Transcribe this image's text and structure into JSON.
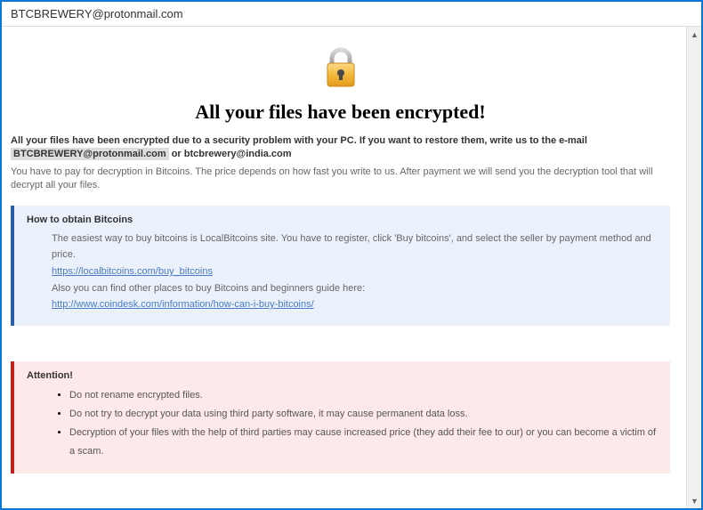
{
  "titlebar": "BTCBREWERY@protonmail.com",
  "heading": "All your files have been encrypted!",
  "intro_bold_prefix": "All your files have been encrypted due to a security problem with your PC. If you want to restore them, write us to the e-mail ",
  "email1": "BTCBREWERY@protonmail.com",
  "intro_bold_sep": " or ",
  "email2": "btcbrewery@india.com",
  "intro_text": "You have to pay for decryption in Bitcoins. The price depends on how fast you write to us. After payment we will send you the decryption tool that will decrypt all your files.",
  "bitcoins": {
    "title": "How to obtain Bitcoins",
    "line1": "The easiest way to buy bitcoins is LocalBitcoins site. You have to register, click 'Buy bitcoins', and select the seller by payment method and price.",
    "link1": "https://localbitcoins.com/buy_bitcoins",
    "line2": "Also you can find other places to buy Bitcoins and beginners guide here:",
    "link2": "http://www.coindesk.com/information/how-can-i-buy-bitcoins/"
  },
  "attention": {
    "title": "Attention!",
    "items": [
      "Do not rename encrypted files.",
      "Do not try to decrypt your data using third party software, it may cause permanent data loss.",
      "Decryption of your files with the help of third parties may cause increased price (they add their fee to our) or you can become a victim of a scam."
    ]
  }
}
